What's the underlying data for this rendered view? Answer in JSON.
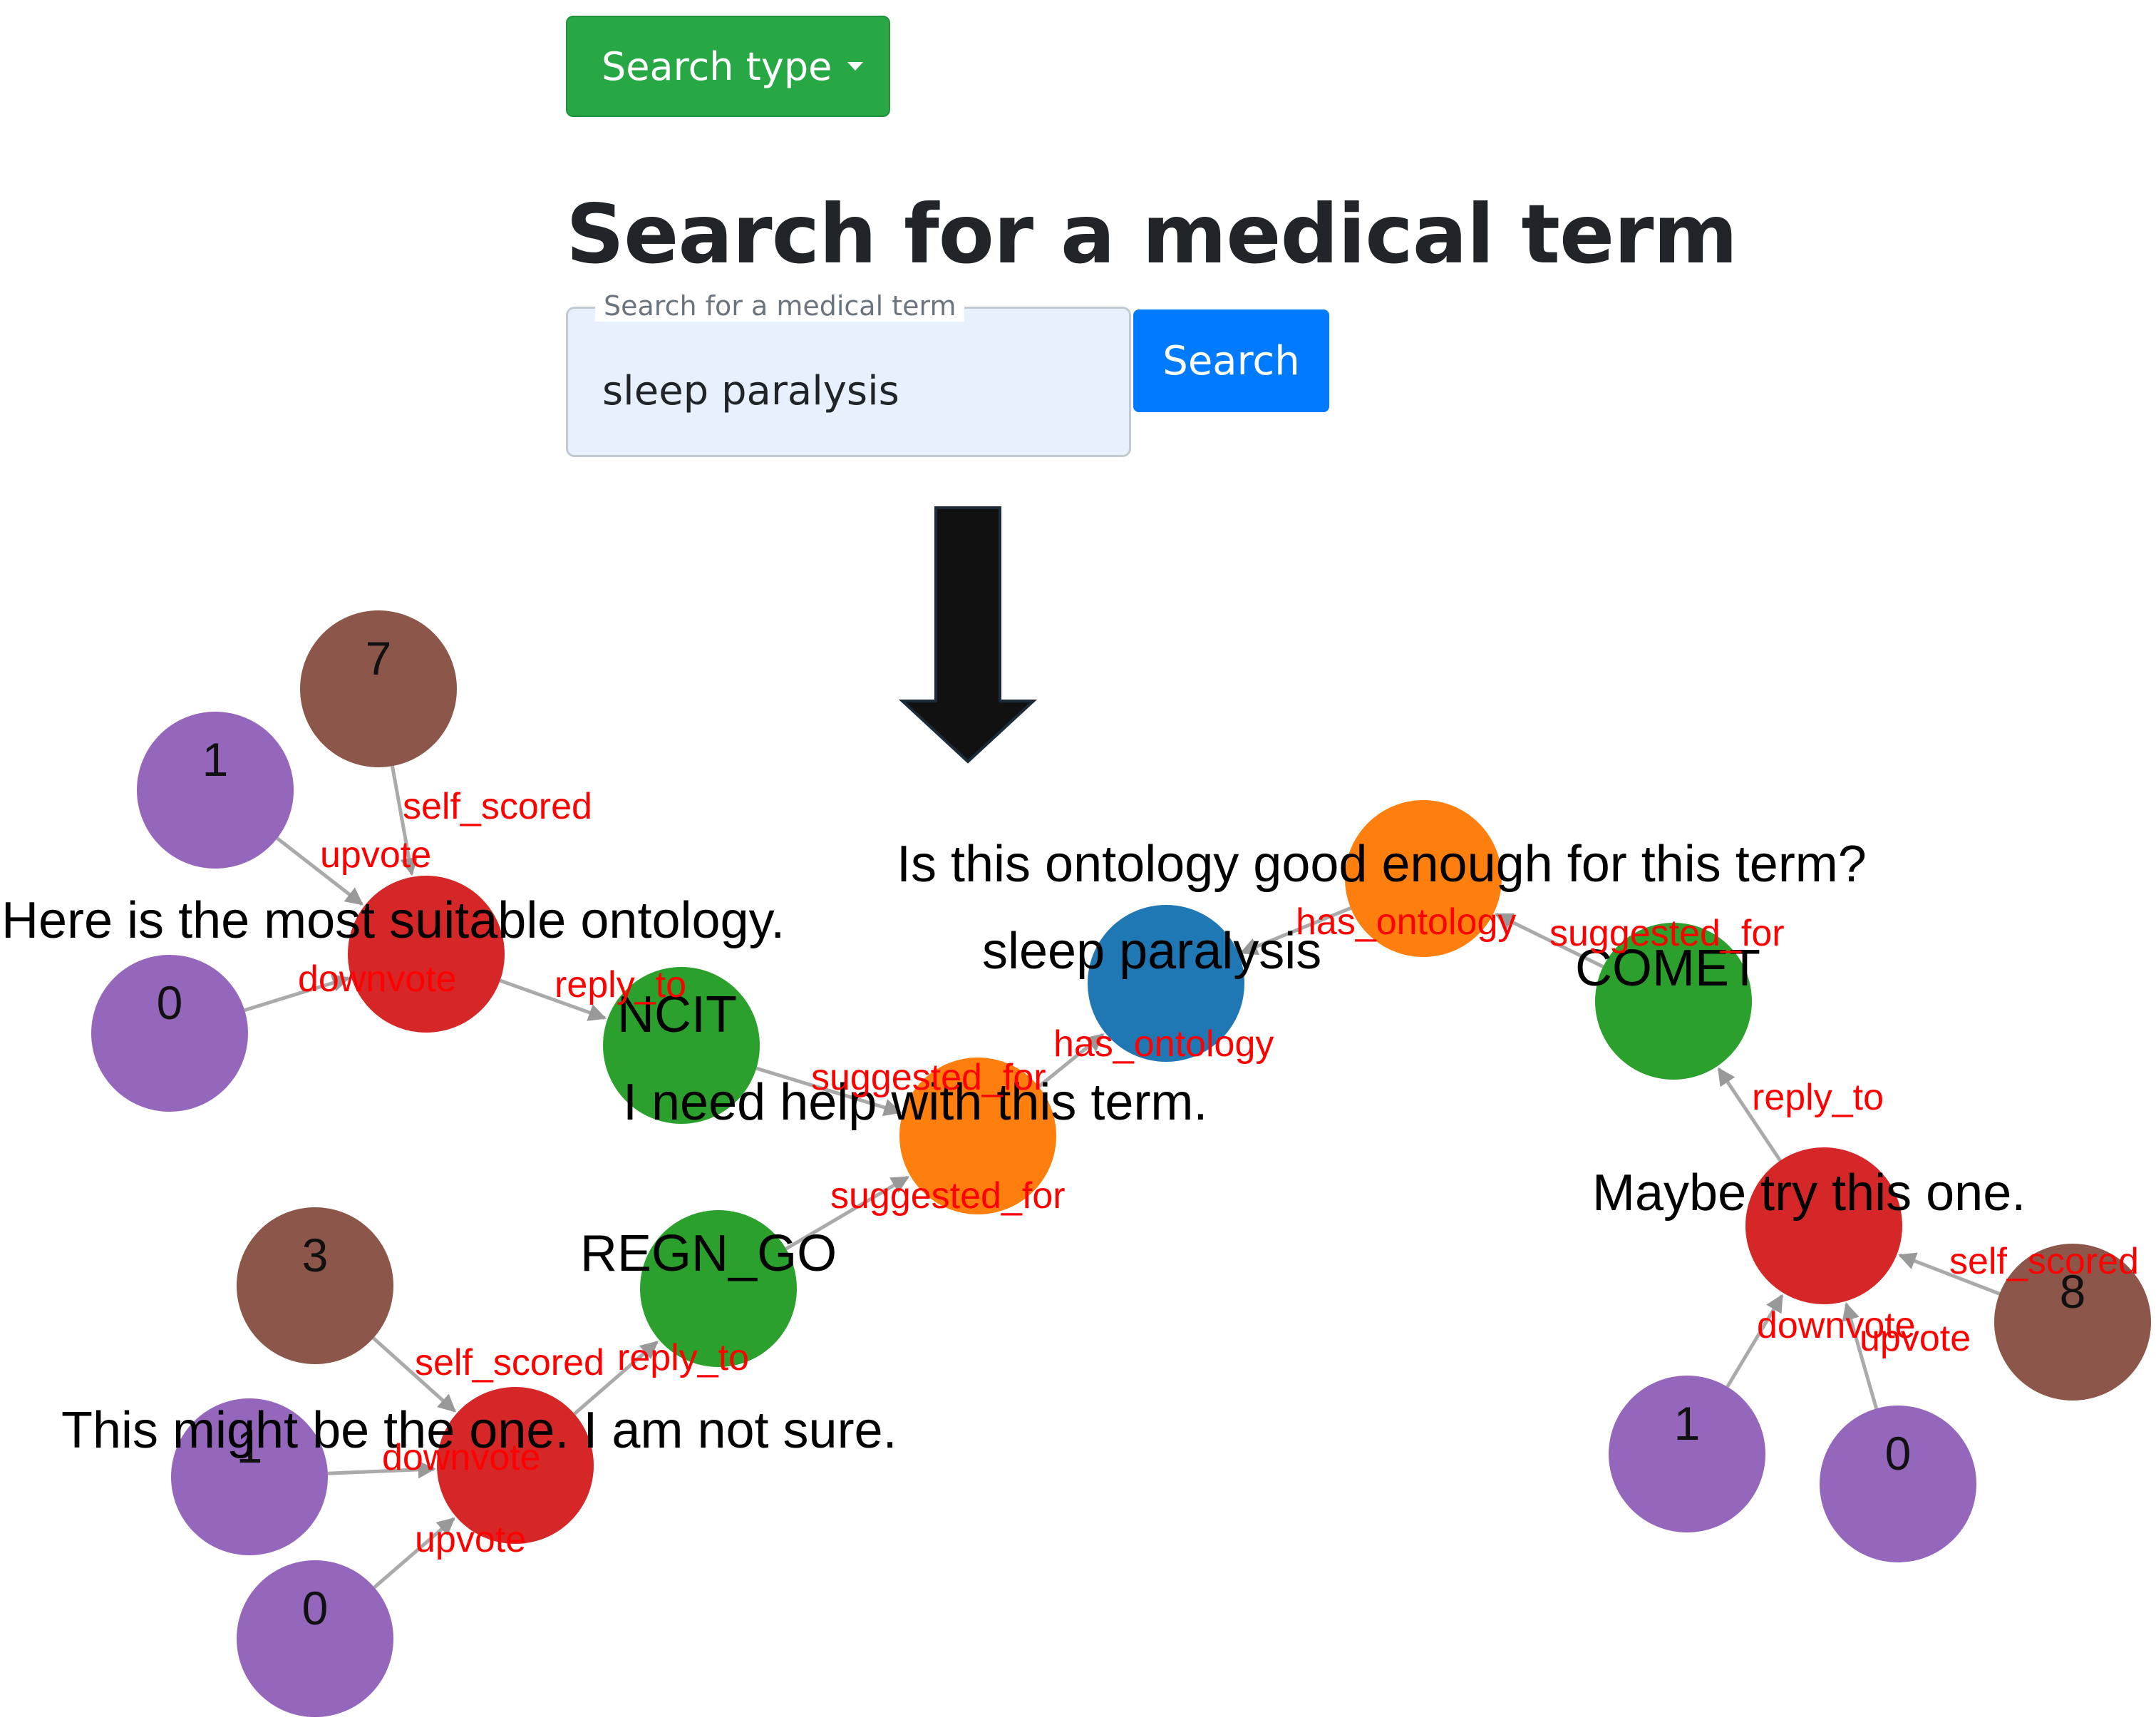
{
  "search_type": {
    "label": "Search type"
  },
  "page_title": "Search for a medical term",
  "search": {
    "floating_label": "Search for a medical term",
    "value": "sleep paralysis",
    "button_label": "Search"
  },
  "graph": {
    "colors": {
      "term": "#1f77b4",
      "question": "#ff7f0e",
      "ontology": "#2ca02c",
      "comment": "#d62728",
      "vote": "#9467bd",
      "score": "#8c564b",
      "edge": "#aaaaaa",
      "edge_label": "#ff0000"
    },
    "nodes": [
      {
        "id": "term",
        "type": "term",
        "text": ""
      },
      {
        "id": "q_top",
        "type": "question",
        "text": ""
      },
      {
        "id": "q_mid",
        "type": "question",
        "text": ""
      },
      {
        "id": "ncit",
        "type": "ontology",
        "text": ""
      },
      {
        "id": "regn",
        "type": "ontology",
        "text": ""
      },
      {
        "id": "comet",
        "type": "ontology",
        "text": ""
      },
      {
        "id": "c_left",
        "type": "comment",
        "text": ""
      },
      {
        "id": "c_bottom",
        "type": "comment",
        "text": ""
      },
      {
        "id": "c_right",
        "type": "comment",
        "text": ""
      },
      {
        "id": "s7",
        "type": "score",
        "text": "7"
      },
      {
        "id": "v1a",
        "type": "vote",
        "text": "1"
      },
      {
        "id": "v0a",
        "type": "vote",
        "text": "0"
      },
      {
        "id": "s3",
        "type": "score",
        "text": "3"
      },
      {
        "id": "v1b",
        "type": "vote",
        "text": "1"
      },
      {
        "id": "v0b",
        "type": "vote",
        "text": "0"
      },
      {
        "id": "s8",
        "type": "score",
        "text": "8"
      },
      {
        "id": "v1c",
        "type": "vote",
        "text": "1"
      },
      {
        "id": "v0c",
        "type": "vote",
        "text": "0"
      }
    ],
    "node_labels": [
      {
        "text": "Is this ontology good enough for this term?"
      },
      {
        "text": "Here is the most suitable ontology."
      },
      {
        "text": "sleep paralysis"
      },
      {
        "text": "COMET"
      },
      {
        "text": "NCIT"
      },
      {
        "text": "I need help with this term."
      },
      {
        "text": "Maybe try this one."
      },
      {
        "text": "REGN_GO"
      },
      {
        "text": "This might be the one. I am not sure."
      }
    ],
    "edges": [
      {
        "from": "s7",
        "to": "c_left",
        "label": "self_scored"
      },
      {
        "from": "v1a",
        "to": "c_left",
        "label": "upvote"
      },
      {
        "from": "v0a",
        "to": "c_left",
        "label": "downvote"
      },
      {
        "from": "c_left",
        "to": "ncit",
        "label": "reply_to"
      },
      {
        "from": "ncit",
        "to": "q_mid",
        "label": "suggested_for"
      },
      {
        "from": "q_mid",
        "to": "term",
        "label": "has_ontology"
      },
      {
        "from": "q_top",
        "to": "term",
        "label": "has_ontology"
      },
      {
        "from": "comet",
        "to": "q_top",
        "label": "suggested_for"
      },
      {
        "from": "c_right",
        "to": "comet",
        "label": "reply_to"
      },
      {
        "from": "s8",
        "to": "c_right",
        "label": "self_scored"
      },
      {
        "from": "v1c",
        "to": "c_right",
        "label": "downvote"
      },
      {
        "from": "v0c",
        "to": "c_right",
        "label": "upvote"
      },
      {
        "from": "regn",
        "to": "q_mid",
        "label": "suggested_for"
      },
      {
        "from": "c_bottom",
        "to": "regn",
        "label": "reply_to"
      },
      {
        "from": "s3",
        "to": "c_bottom",
        "label": "self_scored"
      },
      {
        "from": "v1b",
        "to": "c_bottom",
        "label": "downvote"
      },
      {
        "from": "v0b",
        "to": "c_bottom",
        "label": "upvote"
      }
    ]
  }
}
